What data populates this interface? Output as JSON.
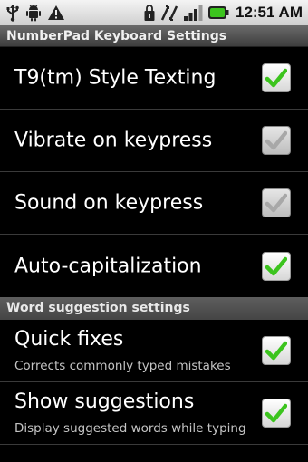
{
  "status_bar": {
    "left_icons": [
      "usb-icon",
      "android-debug-icon",
      "warning-icon"
    ],
    "right_icons": [
      "sim-lock-icon",
      "data-transfer-icon",
      "signal-icon",
      "battery-icon"
    ],
    "time": "12:51 AM"
  },
  "title_bar": {
    "title": "NumberPad Keyboard Settings"
  },
  "settings": [
    {
      "label": "T9(tm) Style Texting",
      "checked": true,
      "enabled": true
    },
    {
      "label": "Vibrate on keypress",
      "checked": true,
      "enabled": false
    },
    {
      "label": "Sound on keypress",
      "checked": true,
      "enabled": false
    },
    {
      "label": "Auto-capitalization",
      "checked": true,
      "enabled": true
    }
  ],
  "word_section": {
    "header": "Word suggestion settings",
    "items": [
      {
        "label": "Quick fixes",
        "summary": "Corrects commonly typed mistakes",
        "checked": true,
        "enabled": true
      },
      {
        "label": "Show suggestions",
        "summary": "Display suggested words while typing",
        "checked": true,
        "enabled": true
      }
    ]
  },
  "colors": {
    "check_enabled": "#3cc41e",
    "check_disabled": "#a8a8a8",
    "background": "#000000"
  }
}
